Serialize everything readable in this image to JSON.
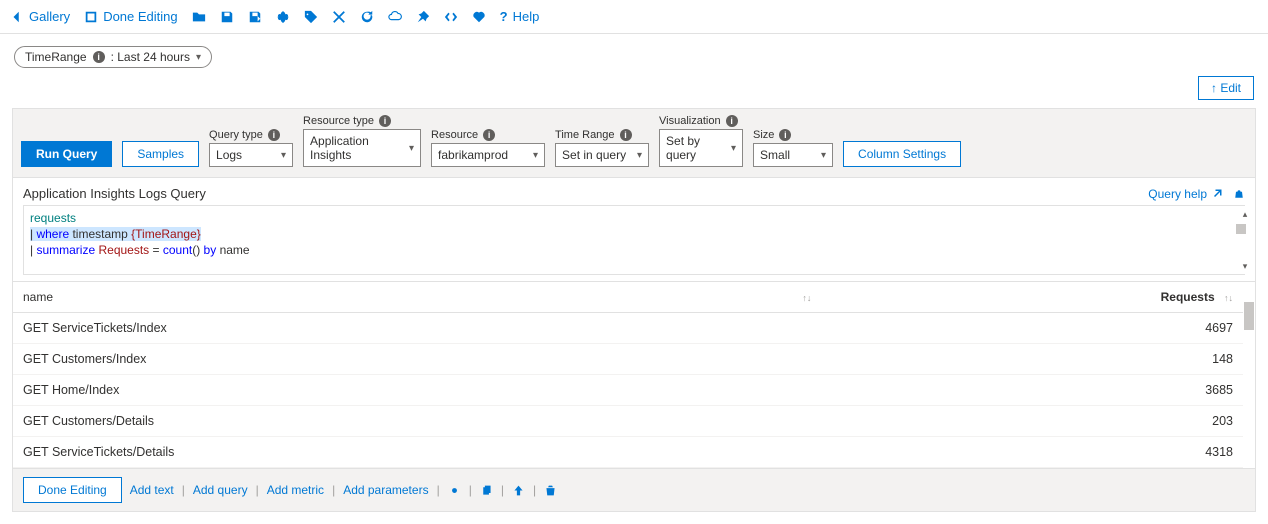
{
  "toolbar": {
    "gallery": "Gallery",
    "done_editing": "Done Editing",
    "help": "Help"
  },
  "time_pill": {
    "label": "TimeRange",
    "value": ": Last 24 hours"
  },
  "edit_button": "↑ Edit",
  "qconfig": {
    "run": "Run Query",
    "samples": "Samples",
    "query_type": {
      "label": "Query type",
      "value": "Logs"
    },
    "resource_type": {
      "label": "Resource type",
      "value": "Application Insights"
    },
    "resource": {
      "label": "Resource",
      "value": "fabrikamprod"
    },
    "time_range": {
      "label": "Time Range",
      "value": "Set in query"
    },
    "visualization": {
      "label": "Visualization",
      "value": "Set by query"
    },
    "size": {
      "label": "Size",
      "value": "Small"
    },
    "column_settings": "Column Settings"
  },
  "query_title": "Application Insights Logs Query",
  "query_help": "Query help",
  "query": {
    "line1_tbl": "requests",
    "line2_pipe": "| ",
    "line2_kw": "where",
    "line2_ts": " timestamp ",
    "line2_param": "{TimeRange}",
    "line3_pipe": "| ",
    "line3_kw": "summarize",
    "line3_fld": " Requests",
    "line3_rest1": " = ",
    "line3_fn": "count",
    "line3_rest2": "() ",
    "line3_by": "by",
    "line3_rest3": " name"
  },
  "results": {
    "columns": {
      "name": "name",
      "requests": "Requests"
    },
    "rows": [
      {
        "name": "GET ServiceTickets/Index",
        "requests": 4697
      },
      {
        "name": "GET Customers/Index",
        "requests": 148
      },
      {
        "name": "GET Home/Index",
        "requests": 3685
      },
      {
        "name": "GET Customers/Details",
        "requests": 203
      },
      {
        "name": "GET ServiceTickets/Details",
        "requests": 4318
      }
    ]
  },
  "footer": {
    "done": "Done Editing",
    "add_text": "Add text",
    "add_query": "Add query",
    "add_metric": "Add metric",
    "add_params": "Add parameters"
  }
}
